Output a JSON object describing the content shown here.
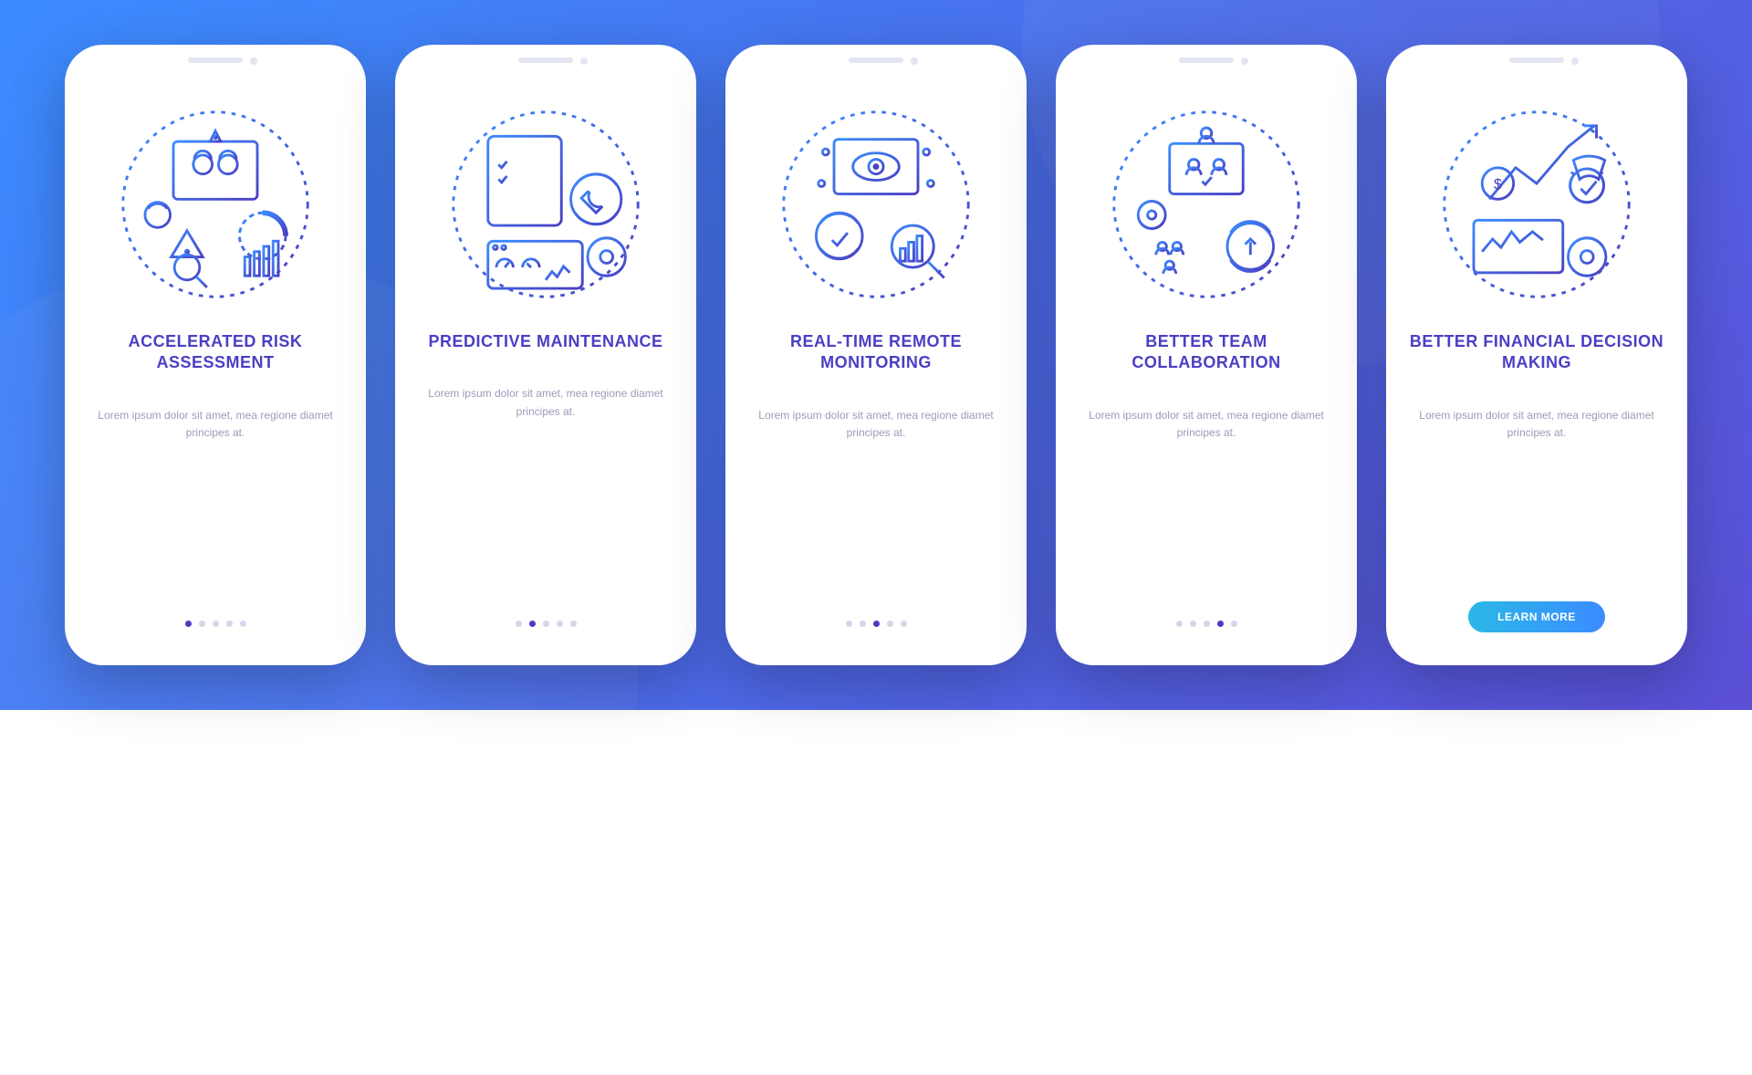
{
  "slides": [
    {
      "title": "ACCELERATED RISK ASSESSMENT",
      "desc": "Lorem ipsum dolor sit amet, mea regione diamet principes at.",
      "active": 0
    },
    {
      "title": "PREDICTIVE MAINTENANCE",
      "desc": "Lorem ipsum dolor sit amet, mea regione diamet principes at.",
      "active": 1
    },
    {
      "title": "REAL-TIME REMOTE MONITORING",
      "desc": "Lorem ipsum dolor sit amet, mea regione diamet principes at.",
      "active": 2
    },
    {
      "title": "BETTER TEAM COLLABORATION",
      "desc": "Lorem ipsum dolor sit amet, mea regione diamet principes at.",
      "active": 3
    },
    {
      "title": "BETTER FINANCIAL DECISION MAKING",
      "desc": "Lorem ipsum dolor sit amet, mea regione diamet principes at.",
      "active": 4
    }
  ],
  "cta_label": "LEARN MORE",
  "total_dots": 5
}
